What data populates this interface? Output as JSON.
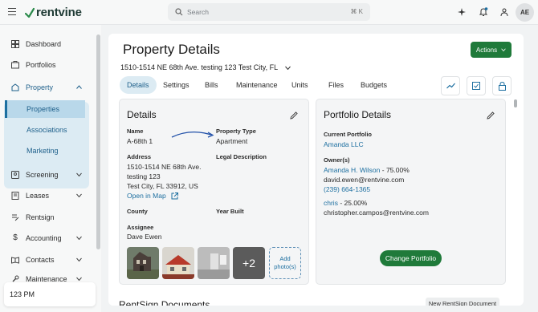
{
  "header": {
    "brand": "rentvine",
    "search_placeholder": "Search",
    "search_shortcut": "⌘ K",
    "avatar_initials": "AE"
  },
  "sidebar": {
    "items": [
      {
        "label": "Dashboard",
        "icon": "dashboard-icon"
      },
      {
        "label": "Portfolios",
        "icon": "portfolio-icon"
      },
      {
        "label": "Property",
        "icon": "property-icon"
      },
      {
        "label": "Screening",
        "icon": "screening-icon"
      },
      {
        "label": "Leases",
        "icon": "lease-icon"
      },
      {
        "label": "Rentsign",
        "icon": "rentsign-icon"
      },
      {
        "label": "Accounting",
        "icon": "dollar-icon"
      },
      {
        "label": "Contacts",
        "icon": "contacts-icon"
      },
      {
        "label": "Maintenance",
        "icon": "maintenance-icon"
      }
    ],
    "property_subitems": [
      "Properties",
      "Associations",
      "Marketing"
    ],
    "active_subitem": "Properties",
    "user_label": "123 PM"
  },
  "page": {
    "title": "Property Details",
    "address_selector": "1510-1514 NE 68th Ave. testing 123 Test City, FL",
    "actions_label": "Actions",
    "tabs": [
      "Details",
      "Settings",
      "Bills",
      "Maintenance",
      "Units",
      "Files",
      "Budgets"
    ],
    "active_tab": "Details"
  },
  "details_card": {
    "title": "Details",
    "name_label": "Name",
    "name_value": "A-68th 1",
    "type_label": "Property Type",
    "type_value": "Apartment",
    "address_label": "Address",
    "address_lines": [
      "1510-1514 NE 68th Ave.",
      "testing 123",
      "Test City, FL 33912, US"
    ],
    "open_map": "Open in Map",
    "legal_label": "Legal Description",
    "county_label": "County",
    "year_label": "Year Built",
    "assignee_label": "Assignee",
    "assignee_value": "Dave Ewen",
    "more_photos": "+2",
    "add_photos": "Add photo(s)"
  },
  "portfolio_card": {
    "title": "Portfolio Details",
    "current_label": "Current Portfolio",
    "current_value": "Amanda LLC",
    "owners_label": "Owner(s)",
    "owners": [
      {
        "name": "Amanda H. Wilson",
        "share": "- 75.00%",
        "email": "david.ewen@rentvine.com",
        "phone": "(239) 664-1365"
      },
      {
        "name": "chris",
        "share": "- 25.00%",
        "email": "christopher.campos@rentvine.com",
        "phone": ""
      }
    ],
    "change_button": "Change Portfolio"
  },
  "rentsign": {
    "title": "RentSign Documents",
    "new_button": "New RentSign Document"
  },
  "colors": {
    "accent_green": "#1f7a3a",
    "link_blue": "#1d6fa0",
    "active_bg": "#dcebf3"
  }
}
